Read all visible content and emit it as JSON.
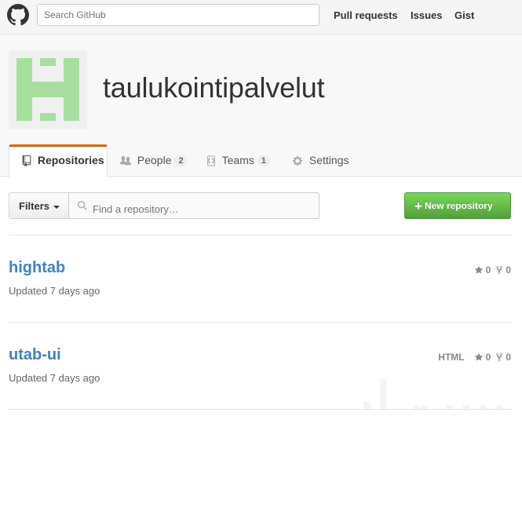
{
  "header": {
    "search_placeholder": "Search GitHub",
    "nav": [
      "Pull requests",
      "Issues",
      "Gist"
    ]
  },
  "org": {
    "name": "taulukointipalvelut",
    "avatar_color": "#a7df9f"
  },
  "tabs": [
    {
      "label": "Repositories",
      "selected": true
    },
    {
      "label": "People",
      "count": "2"
    },
    {
      "label": "Teams",
      "count": "1"
    },
    {
      "label": "Settings"
    }
  ],
  "filters": {
    "label": "Filters",
    "find_placeholder": "Find a repository…",
    "new_repo_label": "New repository"
  },
  "repos": [
    {
      "name": "hightab",
      "updated": "Updated 7 days ago",
      "language": "",
      "stars": "0",
      "forks": "0"
    },
    {
      "name": "utab-ui",
      "updated": "Updated 7 days ago",
      "language": "HTML",
      "stars": "0",
      "forks": "0",
      "activity": [
        2,
        0,
        8,
        0,
        0,
        0,
        1,
        1,
        0,
        0,
        1,
        0,
        1,
        0,
        1,
        0,
        1,
        0
      ]
    }
  ],
  "colors": {
    "accent_tab": "#d26911",
    "link": "#4183c4",
    "button_green": "#6cc644",
    "activity_bar": "#f4f4f4"
  }
}
